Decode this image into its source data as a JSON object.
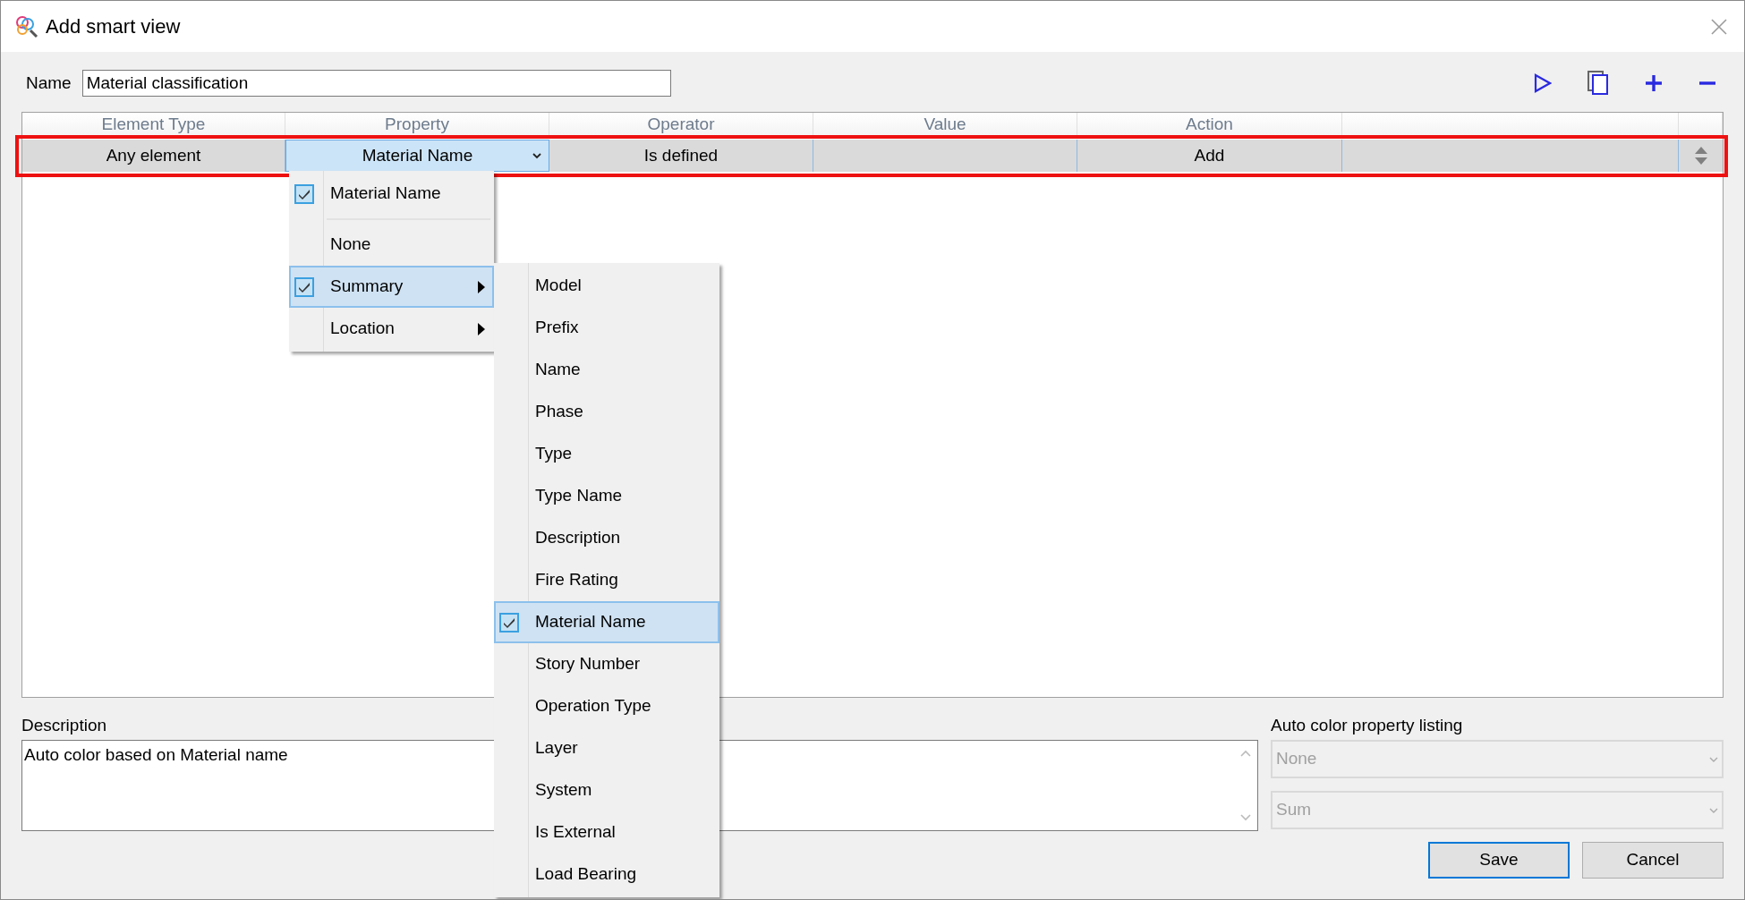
{
  "window": {
    "title": "Add smart view"
  },
  "name_field": {
    "label": "Name",
    "value": "Material classification"
  },
  "table": {
    "columns": [
      "Element Type",
      "Property",
      "Operator",
      "Value",
      "Action"
    ],
    "rows": [
      {
        "element_type": "Any element",
        "property": "Material Name",
        "operator": "Is defined",
        "action": "Add",
        "highlighted": true
      }
    ]
  },
  "property_menu": {
    "items": [
      {
        "kind": "item",
        "label": "Material Name",
        "checked": true,
        "selected": false,
        "submenu": false
      },
      {
        "kind": "separator"
      },
      {
        "kind": "item",
        "label": "None",
        "checked": false,
        "selected": false,
        "submenu": false
      },
      {
        "kind": "item",
        "label": "Summary",
        "checked": true,
        "selected": true,
        "submenu": true
      },
      {
        "kind": "item",
        "label": "Location",
        "checked": false,
        "selected": false,
        "submenu": true
      }
    ]
  },
  "summary_submenu": {
    "items": [
      {
        "label": "Model",
        "checked": false,
        "selected": false
      },
      {
        "label": "Prefix",
        "checked": false,
        "selected": false
      },
      {
        "label": "Name",
        "checked": false,
        "selected": false
      },
      {
        "label": "Phase",
        "checked": false,
        "selected": false
      },
      {
        "label": "Type",
        "checked": false,
        "selected": false
      },
      {
        "label": "Type Name",
        "checked": false,
        "selected": false
      },
      {
        "label": "Description",
        "checked": false,
        "selected": false
      },
      {
        "label": "Fire Rating",
        "checked": false,
        "selected": false
      },
      {
        "label": "Material Name",
        "checked": true,
        "selected": true
      },
      {
        "label": "Story Number",
        "checked": false,
        "selected": false
      },
      {
        "label": "Operation Type",
        "checked": false,
        "selected": false
      },
      {
        "label": "Layer",
        "checked": false,
        "selected": false
      },
      {
        "label": "System",
        "checked": false,
        "selected": false
      },
      {
        "label": "Is External",
        "checked": false,
        "selected": false
      },
      {
        "label": "Load Bearing",
        "checked": false,
        "selected": false
      }
    ]
  },
  "description": {
    "label": "Description",
    "value": "Auto color based on Material name"
  },
  "auto_color": {
    "label": "Auto color property listing",
    "fields": [
      {
        "value": "None",
        "disabled": true
      },
      {
        "value": "Sum",
        "disabled": true
      }
    ]
  },
  "buttons": [
    {
      "label": "Save",
      "default": true
    },
    {
      "label": "Cancel",
      "default": false
    }
  ]
}
